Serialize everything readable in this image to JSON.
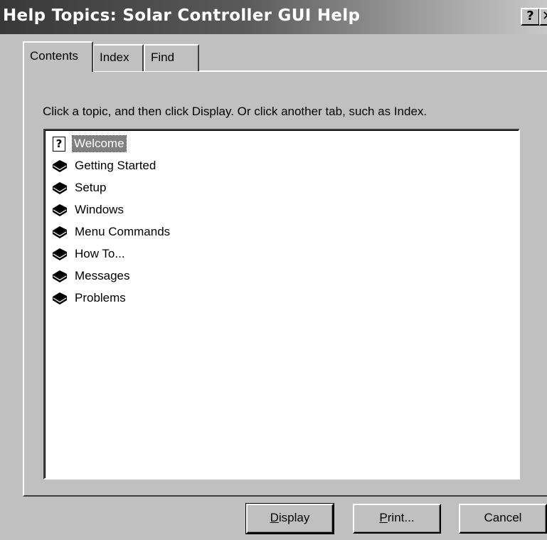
{
  "window": {
    "title": "Help Topics: Solar Controller GUI Help",
    "help_button": "?",
    "close_button": "✕"
  },
  "tabs": [
    {
      "label": "Contents",
      "selected": true
    },
    {
      "label": "Index",
      "selected": false
    },
    {
      "label": "Find",
      "selected": false
    }
  ],
  "instruction": "Click a topic, and then click Display. Or click another tab, such as Index.",
  "topics": [
    {
      "label": "Welcome",
      "icon": "question-page-icon",
      "selected": true
    },
    {
      "label": "Getting Started",
      "icon": "book-icon"
    },
    {
      "label": "Setup",
      "icon": "book-icon"
    },
    {
      "label": "Windows",
      "icon": "book-icon"
    },
    {
      "label": "Menu Commands",
      "icon": "book-icon"
    },
    {
      "label": "How To...",
      "icon": "book-icon"
    },
    {
      "label": "Messages",
      "icon": "book-icon"
    },
    {
      "label": "Problems",
      "icon": "book-icon"
    }
  ],
  "buttons": {
    "display": {
      "mnemonic": "D",
      "rest": "isplay"
    },
    "print": {
      "mnemonic": "P",
      "rest": "rint..."
    },
    "cancel": "Cancel"
  }
}
